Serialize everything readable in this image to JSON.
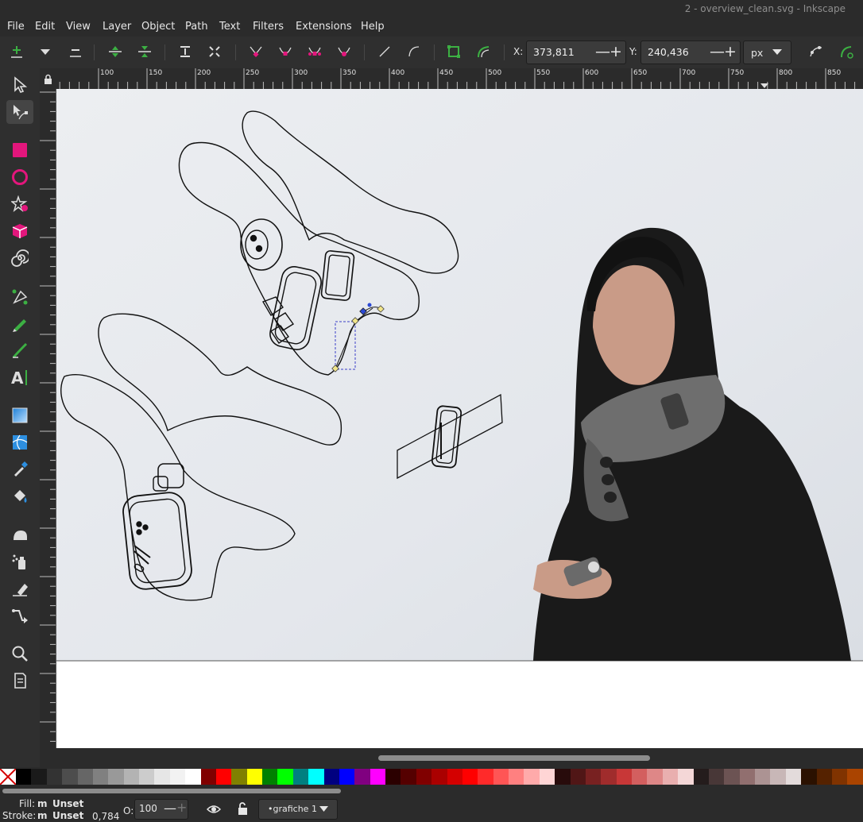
{
  "window": {
    "title": "2 - overview_clean.svg - Inkscape"
  },
  "menu": [
    "File",
    "Edit",
    "View",
    "Layer",
    "Object",
    "Path",
    "Text",
    "Filters",
    "Extensions",
    "Help"
  ],
  "toolbar": {
    "x_label": "X:",
    "x_value": "373,811",
    "y_label": "Y:",
    "y_value": "240,436",
    "unit": "px",
    "minus_sign": "—",
    "plus_sign": "+"
  },
  "tools": [
    "selector-tool",
    "node-tool",
    "rectangle-tool",
    "ellipse-tool",
    "star-tool",
    "3dbox-tool",
    "spiral-tool",
    "bezier-tool",
    "pencil-tool",
    "calligraphy-tool",
    "text-tool",
    "gradient-tool",
    "mesh-tool",
    "dropper-tool",
    "paint-bucket-tool",
    "tweak-tool",
    "spray-tool",
    "eraser-tool",
    "connector-tool",
    "zoom-tool",
    "document-properties-tool"
  ],
  "ruler": {
    "labels": [
      "100",
      "150",
      "200",
      "250",
      "300",
      "350",
      "400",
      "450",
      "500",
      "550",
      "600",
      "650",
      "700",
      "750",
      "800",
      "850"
    ]
  },
  "status": {
    "fill_label": "Fill:",
    "fill_flag": "m",
    "fill_value": "Unset",
    "stroke_label": "Stroke:",
    "stroke_flag": "m",
    "stroke_value": "Unset",
    "stroke_width": "0,784",
    "opacity_label": "O:",
    "opacity_value": "100",
    "layer_name": "•grafiche 1"
  },
  "palette_colors": [
    "#000000",
    "#1a1a1a",
    "#333333",
    "#4d4d4d",
    "#666666",
    "#808080",
    "#999999",
    "#b3b3b3",
    "#cccccc",
    "#e6e6e6",
    "#f2f2f2",
    "#ffffff",
    "#800000",
    "#ff0000",
    "#808000",
    "#ffff00",
    "#008000",
    "#00ff00",
    "#008080",
    "#00ffff",
    "#000080",
    "#0000ff",
    "#800080",
    "#ff00ff",
    "#2b0000",
    "#550000",
    "#800000",
    "#aa0000",
    "#d40000",
    "#ff0000",
    "#ff2a2a",
    "#ff5555",
    "#ff8080",
    "#ffaaaa",
    "#ffd5d5",
    "#280b0b",
    "#501616",
    "#782121",
    "#a02c2c",
    "#c83737",
    "#d35f5f",
    "#de8787",
    "#e9afaf",
    "#f4d7d7",
    "#241c1c",
    "#483737",
    "#6c5353",
    "#916f6f",
    "#ac9393",
    "#c8b7b7",
    "#e3dbdb",
    "#2b1100",
    "#552200",
    "#803300",
    "#aa4400"
  ],
  "accent": "#e3167c"
}
